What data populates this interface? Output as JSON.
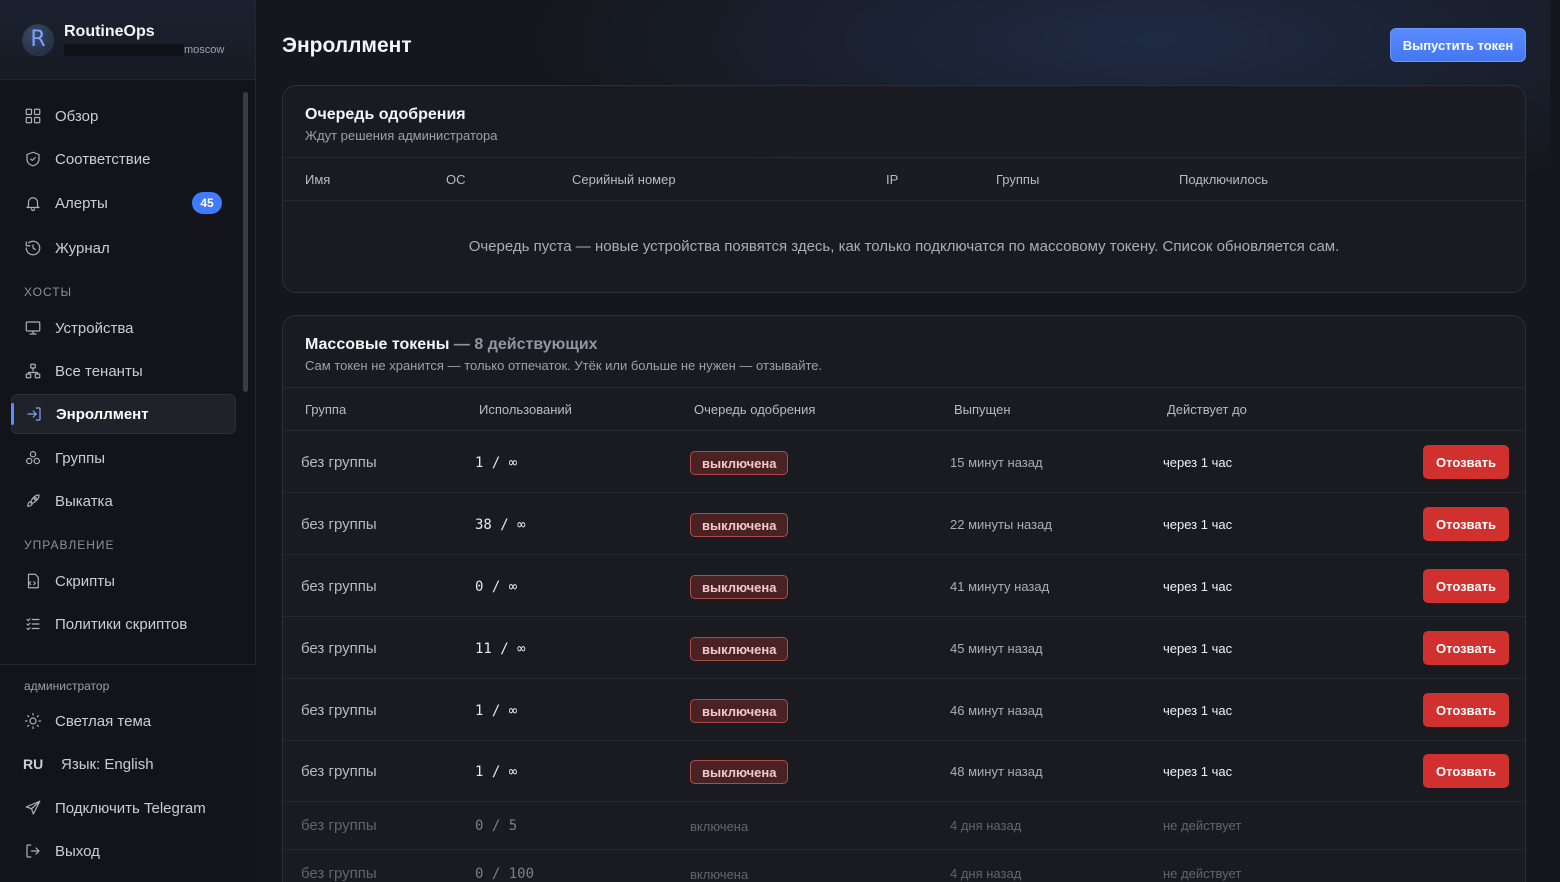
{
  "brand": {
    "name": "RoutineOps",
    "logo_letter": "R",
    "tenant": "moscow"
  },
  "nav": {
    "items": [
      {
        "label": "Обзор",
        "icon": "grid-icon"
      },
      {
        "label": "Соответствие",
        "icon": "shield-check-icon"
      },
      {
        "label": "Алерты",
        "icon": "bell-icon",
        "badge": "45"
      },
      {
        "label": "Журнал",
        "icon": "history-icon"
      }
    ],
    "section_hosts": "Хосты",
    "hosts_items": [
      {
        "label": "Устройства",
        "icon": "monitor-icon"
      },
      {
        "label": "Все тенанты",
        "icon": "network-icon"
      },
      {
        "label": "Энроллмент",
        "icon": "login-icon",
        "active": true
      },
      {
        "label": "Группы",
        "icon": "groups-icon"
      },
      {
        "label": "Выкатка",
        "icon": "rocket-icon"
      }
    ],
    "section_manage": "Управление",
    "manage_items": [
      {
        "label": "Скрипты",
        "icon": "script-icon"
      },
      {
        "label": "Политики скриптов",
        "icon": "list-check-icon"
      }
    ]
  },
  "footer": {
    "role": "администратор",
    "theme_label": "Светлая тема",
    "lang_code": "RU",
    "lang_label": "Язык: English",
    "telegram_label": "Подключить Telegram",
    "logout_label": "Выход"
  },
  "page": {
    "title": "Энроллмент",
    "primary_action": "Выпустить токен"
  },
  "approval_queue": {
    "title": "Очередь одобрения",
    "subtitle": "Ждут решения администратора",
    "columns": [
      "Имя",
      "ОС",
      "Серийный номер",
      "IP",
      "Группы",
      "Подключилось"
    ],
    "empty_message": "Очередь пуста — новые устройства появятся здесь, как только подключатся по массовому токену. Список обновляется сам."
  },
  "mass_tokens": {
    "title": "Массовые токены",
    "title_suffix": "— 8 действующих",
    "subtitle": "Сам токен не хранится — только отпечаток. Утёк или больше не нужен — отзывайте.",
    "columns": [
      "Группа",
      "Использований",
      "Очередь одобрения",
      "Выпущен",
      "Действует до"
    ],
    "revoke_label": "Отозвать",
    "rows": [
      {
        "group": "без группы",
        "uses": "1 / ∞",
        "queue": "выключена",
        "issued": "15 минут назад",
        "valid_until": "через 1 час",
        "active": true
      },
      {
        "group": "без группы",
        "uses": "38 / ∞",
        "queue": "выключена",
        "issued": "22 минуты назад",
        "valid_until": "через 1 час",
        "active": true
      },
      {
        "group": "без группы",
        "uses": "0 / ∞",
        "queue": "выключена",
        "issued": "41 минуту назад",
        "valid_until": "через 1 час",
        "active": true
      },
      {
        "group": "без группы",
        "uses": "11 / ∞",
        "queue": "выключена",
        "issued": "45 минут назад",
        "valid_until": "через 1 час",
        "active": true
      },
      {
        "group": "без группы",
        "uses": "1 / ∞",
        "queue": "выключена",
        "issued": "46 минут назад",
        "valid_until": "через 1 час",
        "active": true
      },
      {
        "group": "без группы",
        "uses": "1 / ∞",
        "queue": "выключена",
        "issued": "48 минут назад",
        "valid_until": "через 1 час",
        "active": true
      },
      {
        "group": "без группы",
        "uses": "0 / 5",
        "queue": "включена",
        "issued": "4 дня назад",
        "valid_until": "не действует",
        "active": false
      },
      {
        "group": "без группы",
        "uses": "0 / 100",
        "queue": "включена",
        "issued": "4 дня назад",
        "valid_until": "не действует",
        "active": false
      }
    ]
  },
  "colors": {
    "accent": "#4a7dff",
    "danger": "#d0302e",
    "badge": "#3f7bff"
  }
}
